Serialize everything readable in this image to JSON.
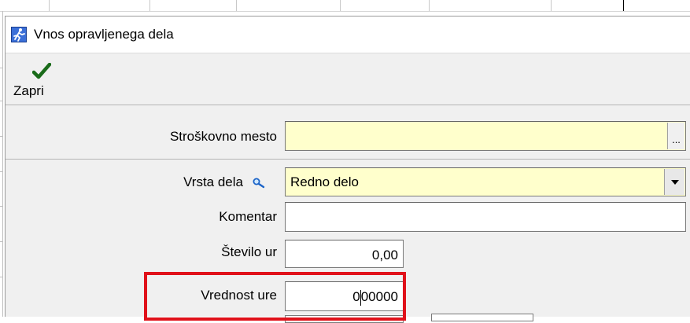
{
  "window": {
    "title": "Vnos opravljenega dela",
    "icon": "app-runner-icon"
  },
  "toolbar": {
    "close_label": "Zapri",
    "close_icon": "checkmark-icon",
    "close_icon_color": "#1a6b1a"
  },
  "form": {
    "cost_center": {
      "label": "Stroškovno mesto",
      "value": "",
      "button": "..."
    },
    "work_type": {
      "label": "Vrsta dela",
      "value": "Redno delo",
      "lookup_icon": "magnifier-icon"
    },
    "comment": {
      "label": "Komentar",
      "value": ""
    },
    "hours": {
      "label": "Število ur",
      "value": "0,00"
    },
    "hour_value": {
      "label": "Vrednost ure",
      "value_before_caret": "0",
      "value_after_caret": "00000"
    }
  },
  "colors": {
    "field_yellow": "#ffffcc",
    "highlight_red": "#e0111a"
  }
}
